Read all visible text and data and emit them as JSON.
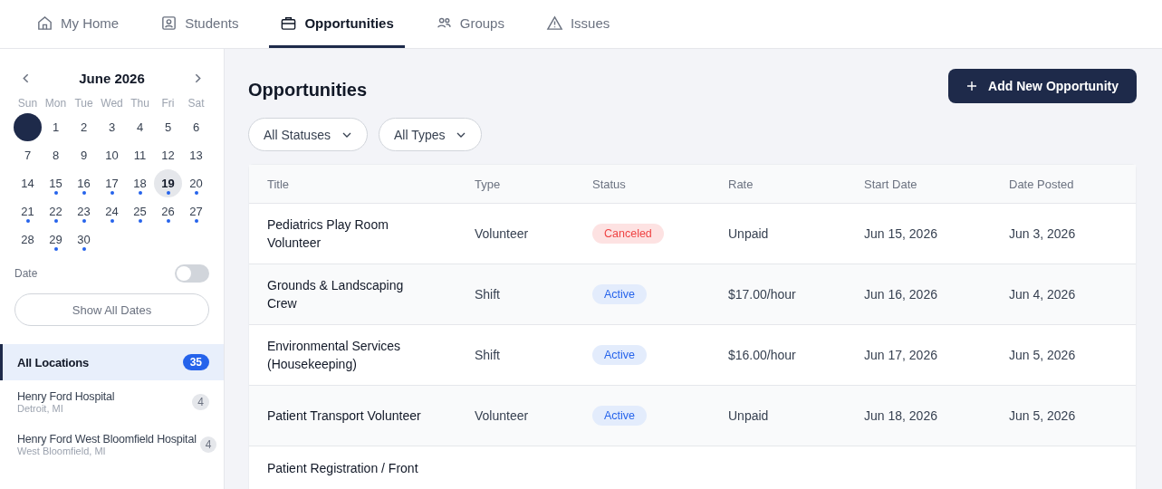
{
  "nav": {
    "tabs": [
      {
        "label": "My Home",
        "selected": false
      },
      {
        "label": "Students",
        "selected": false
      },
      {
        "label": "Opportunities",
        "selected": true
      },
      {
        "label": "Groups",
        "selected": false
      },
      {
        "label": "Issues",
        "selected": false
      }
    ]
  },
  "calendar": {
    "month": "June 2026",
    "weekdays": [
      "Sun",
      "Mon",
      "Tue",
      "Wed",
      "Thu",
      "Fri",
      "Sat"
    ],
    "days": [
      {
        "selected": true,
        "today": false,
        "events": false
      },
      {
        "label": "1",
        "selected": false,
        "today": false,
        "events": false
      },
      {
        "label": "2",
        "selected": false,
        "today": false,
        "events": false
      },
      {
        "label": "3",
        "selected": false,
        "today": false,
        "events": false
      },
      {
        "label": "4",
        "selected": false,
        "today": false,
        "events": false
      },
      {
        "label": "5",
        "selected": false,
        "today": false,
        "events": false
      },
      {
        "label": "6",
        "selected": false,
        "today": false,
        "events": false
      },
      {
        "label": "7",
        "selected": false,
        "today": false,
        "events": false
      },
      {
        "label": "8",
        "selected": false,
        "today": false,
        "events": false
      },
      {
        "label": "9",
        "selected": false,
        "today": false,
        "events": false
      },
      {
        "label": "10",
        "selected": false,
        "today": false,
        "events": false
      },
      {
        "label": "11",
        "selected": false,
        "today": false,
        "events": false
      },
      {
        "label": "12",
        "selected": false,
        "today": false,
        "events": false
      },
      {
        "label": "13",
        "selected": false,
        "today": false,
        "events": false
      },
      {
        "label": "14",
        "selected": false,
        "today": false,
        "events": false
      },
      {
        "label": "15",
        "selected": false,
        "today": false,
        "events": true
      },
      {
        "label": "16",
        "selected": false,
        "today": false,
        "events": true
      },
      {
        "label": "17",
        "selected": false,
        "today": false,
        "events": true
      },
      {
        "label": "18",
        "selected": false,
        "today": false,
        "events": true
      },
      {
        "label": "19",
        "selected": false,
        "today": true,
        "events": true
      },
      {
        "label": "20",
        "selected": false,
        "today": false,
        "events": true
      },
      {
        "label": "21",
        "selected": false,
        "today": false,
        "events": true
      },
      {
        "label": "22",
        "selected": false,
        "today": false,
        "events": true
      },
      {
        "label": "23",
        "selected": false,
        "today": false,
        "events": true
      },
      {
        "label": "24",
        "selected": false,
        "today": false,
        "events": true
      },
      {
        "label": "25",
        "selected": false,
        "today": false,
        "events": true
      },
      {
        "label": "26",
        "selected": false,
        "today": false,
        "events": true
      },
      {
        "label": "27",
        "selected": false,
        "today": false,
        "events": true
      },
      {
        "label": "28",
        "selected": false,
        "today": false,
        "events": false
      },
      {
        "label": "29",
        "selected": false,
        "today": false,
        "events": true
      },
      {
        "label": "30",
        "selected": false,
        "today": false,
        "events": true
      }
    ]
  },
  "date_filter": {
    "label": "Date",
    "on": false
  },
  "show_all_button": "Show All Dates",
  "locations": [
    {
      "name": "All Locations",
      "count": "35",
      "selected": true
    },
    {
      "name": "Henry Ford Hospital",
      "sub": "Detroit, MI",
      "count": "4",
      "selected": false
    },
    {
      "name": "Henry Ford West Bloomfield Hospital",
      "sub": "West Bloomfield, MI",
      "count": "4",
      "selected": false
    }
  ],
  "page_title": "Opportunities",
  "add_button": "Add New Opportunity",
  "filters": [
    "All Statuses",
    "All Types"
  ],
  "table": {
    "columns": [
      "Title",
      "Type",
      "Status",
      "Rate",
      "Start Date",
      "Date Posted"
    ],
    "rows": [
      {
        "title": "Pediatrics Play Room Volunteer",
        "type": "Volunteer",
        "status": "Canceled",
        "kind": "canceled",
        "rate": "Unpaid",
        "start": "Jun 15, 2026",
        "posted": "Jun 3, 2026"
      },
      {
        "title": "Grounds & Landscaping Crew",
        "type": "Shift",
        "status": "Active",
        "kind": "active",
        "rate": "$17.00/hour",
        "start": "Jun 16, 2026",
        "posted": "Jun 4, 2026"
      },
      {
        "title": "Environmental Services (Housekeeping)",
        "type": "Shift",
        "status": "Active",
        "kind": "active",
        "rate": "$16.00/hour",
        "start": "Jun 17, 2026",
        "posted": "Jun 5, 2026"
      },
      {
        "title": "Patient Transport Volunteer",
        "type": "Volunteer",
        "status": "Active",
        "kind": "active",
        "rate": "Unpaid",
        "start": "Jun 18, 2026",
        "posted": "Jun 5, 2026"
      },
      {
        "title": "Patient Registration / Front"
      }
    ]
  }
}
